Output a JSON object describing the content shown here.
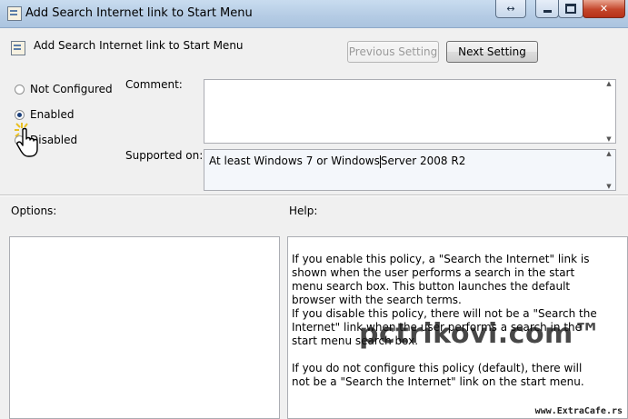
{
  "window": {
    "title": "Add Search Internet link to Start Menu",
    "resize_glyph": "↔",
    "close_glyph": "✕"
  },
  "header": {
    "policy_title": "Add Search Internet link to Start Menu",
    "previous_label": "Previous Setting",
    "next_label": "Next Setting"
  },
  "state": {
    "options": [
      {
        "label": "Not Configured",
        "selected": false
      },
      {
        "label": "Enabled",
        "selected": true
      },
      {
        "label": "Disabled",
        "selected": false
      }
    ]
  },
  "comment": {
    "label": "Comment:",
    "value": ""
  },
  "supported": {
    "label": "Supported on:",
    "value_before": "At least Windows 7 or Windows",
    "value_after": "Server 2008 R2"
  },
  "options_pane": {
    "label": "Options:"
  },
  "help_pane": {
    "label": "Help:",
    "paragraphs": [
      "If you enable this policy, a \"Search the Internet\" link is shown when the user performs a search in the start menu search box. This button launches the default browser with the search terms.",
      "If you disable this policy, there will not be a \"Search the Internet\" link when the user performs a search in the start menu search box.",
      "If you do not configure this policy (default), there will not be a \"Search the Internet\" link on the start menu."
    ]
  },
  "watermarks": {
    "main": "pctrikovi.com™",
    "corner": "www.ExtraCafe.rs"
  },
  "icons": {
    "app": "policy-document-icon",
    "cursor": "hand-pointer-icon"
  }
}
